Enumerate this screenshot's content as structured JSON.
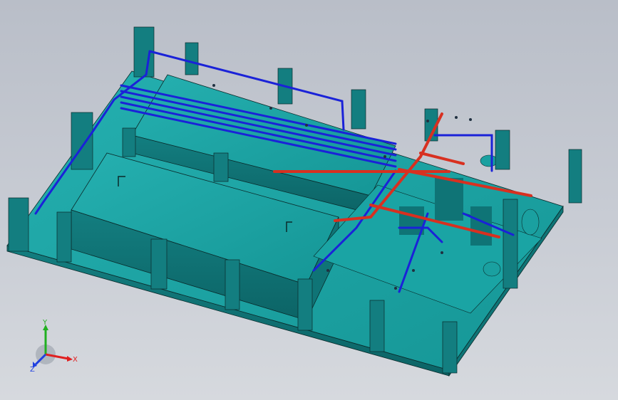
{
  "triad": {
    "x_label": "X",
    "y_label": "Y",
    "z_label": "Z",
    "x_color": "#e02020",
    "y_color": "#20b020",
    "z_color": "#2040e0"
  },
  "scene": {
    "model_color": "#1a9a9a",
    "model_shadow": "#0c5e60",
    "edge_color": "#0a2a2a",
    "pipe_blue": "#1a22d8",
    "pipe_red": "#d83020"
  }
}
